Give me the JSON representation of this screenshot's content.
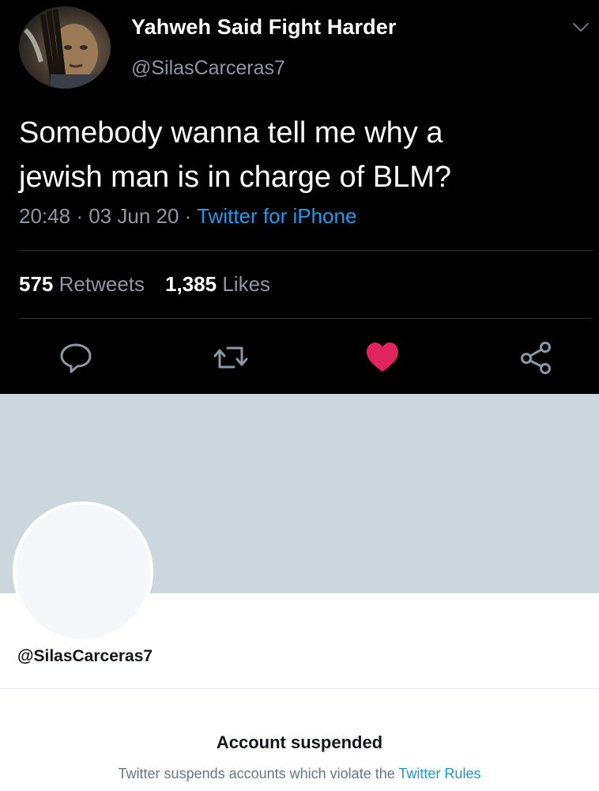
{
  "tweet": {
    "author": {
      "display_name": "Yahweh Said Fight Harder",
      "handle": "@SilasCarceras7"
    },
    "text_line1": "Somebody wanna tell me why a",
    "text_line2": "jewish man is in charge of BLM?",
    "time": "20:48",
    "separator": "·",
    "date": "03 Jun 20",
    "source": "Twitter for iPhone",
    "retweets_count": "575",
    "retweets_label": "Retweets",
    "likes_count": "1,385",
    "likes_label": "Likes",
    "liked": true,
    "icons": {
      "menu": "chevron-down-icon",
      "reply": "reply-icon",
      "retweet": "retweet-icon",
      "like": "heart-icon",
      "share": "share-icon"
    }
  },
  "profile": {
    "handle": "@SilasCarceras7",
    "suspended_title": "Account suspended",
    "suspended_text": "Twitter suspends accounts which violate the",
    "rules_link": "Twitter Rules"
  },
  "colors": {
    "dark_background": "#000000",
    "secondary_text": "#8b98a5",
    "link_blue": "#1d9bf0",
    "like_red": "#e0245e",
    "banner_gray": "#ccd6dd"
  }
}
